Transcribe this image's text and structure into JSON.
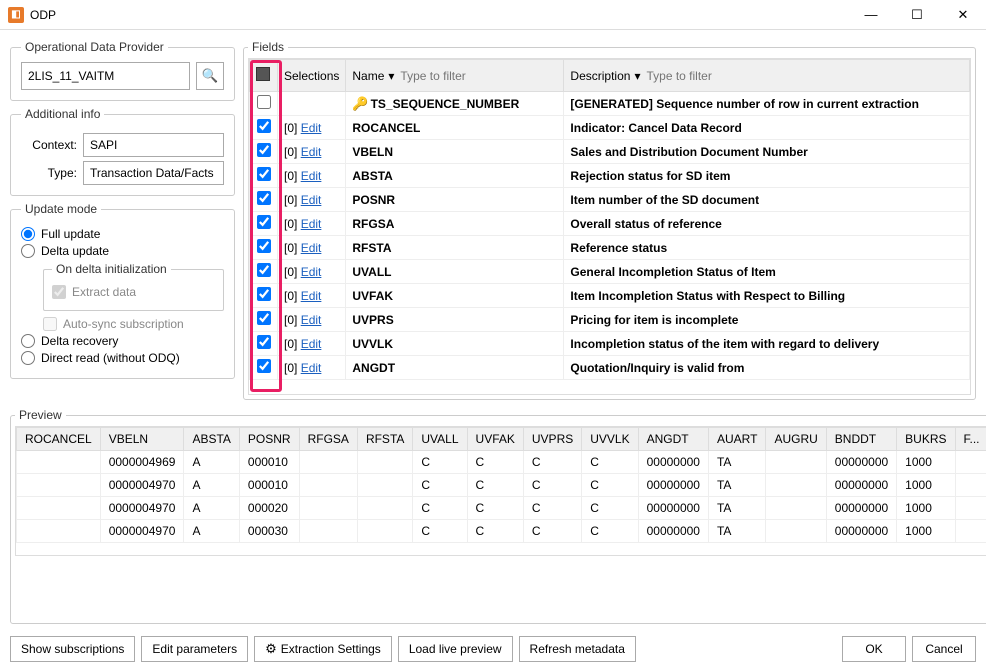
{
  "window": {
    "title": "ODP"
  },
  "odp": {
    "legend": "Operational Data Provider",
    "value": "2LIS_11_VAITM"
  },
  "additional": {
    "legend": "Additional info",
    "context_label": "Context:",
    "context_value": "SAPI",
    "type_label": "Type:",
    "type_value": "Transaction Data/Facts"
  },
  "update": {
    "legend": "Update mode",
    "full": "Full update",
    "delta": "Delta update",
    "delta_init_legend": "On delta initialization",
    "extract": "Extract data",
    "autosync": "Auto-sync subscription",
    "recovery": "Delta recovery",
    "direct": "Direct read (without ODQ)"
  },
  "fields": {
    "legend": "Fields",
    "selections_header": "Selections",
    "name_header": "Name",
    "name_placeholder": "Type to filter",
    "desc_header": "Description",
    "desc_placeholder": "Type to filter",
    "sel_text": "[0]",
    "edit_text": "Edit",
    "rows": [
      {
        "checked": false,
        "key": true,
        "sel": false,
        "name": "TS_SEQUENCE_NUMBER",
        "desc": "[GENERATED] Sequence number of row in current extraction"
      },
      {
        "checked": true,
        "key": false,
        "sel": true,
        "name": "ROCANCEL",
        "desc": "Indicator: Cancel Data Record"
      },
      {
        "checked": true,
        "key": false,
        "sel": true,
        "name": "VBELN",
        "desc": "Sales and Distribution Document Number"
      },
      {
        "checked": true,
        "key": false,
        "sel": true,
        "name": "ABSTA",
        "desc": "Rejection status for SD item"
      },
      {
        "checked": true,
        "key": false,
        "sel": true,
        "name": "POSNR",
        "desc": "Item number of the SD document"
      },
      {
        "checked": true,
        "key": false,
        "sel": true,
        "name": "RFGSA",
        "desc": "Overall status of reference"
      },
      {
        "checked": true,
        "key": false,
        "sel": true,
        "name": "RFSTA",
        "desc": "Reference status"
      },
      {
        "checked": true,
        "key": false,
        "sel": true,
        "name": "UVALL",
        "desc": "General Incompletion Status of Item"
      },
      {
        "checked": true,
        "key": false,
        "sel": true,
        "name": "UVFAK",
        "desc": "Item Incompletion Status with Respect to Billing"
      },
      {
        "checked": true,
        "key": false,
        "sel": true,
        "name": "UVPRS",
        "desc": "Pricing for item is incomplete"
      },
      {
        "checked": true,
        "key": false,
        "sel": true,
        "name": "UVVLK",
        "desc": "Incompletion status of the item with regard to delivery"
      },
      {
        "checked": true,
        "key": false,
        "sel": true,
        "name": "ANGDT",
        "desc": "Quotation/Inquiry is valid from"
      }
    ]
  },
  "preview": {
    "legend": "Preview",
    "columns": [
      "ROCANCEL",
      "VBELN",
      "ABSTA",
      "POSNR",
      "RFGSA",
      "RFSTA",
      "UVALL",
      "UVFAK",
      "UVPRS",
      "UVVLK",
      "ANGDT",
      "AUART",
      "AUGRU",
      "BNDDT",
      "BUKRS",
      "F..."
    ],
    "rows": [
      [
        "",
        "0000004969",
        "A",
        "000010",
        "",
        "",
        "C",
        "C",
        "C",
        "C",
        "00000000",
        "TA",
        "",
        "00000000",
        "1000",
        ""
      ],
      [
        "",
        "0000004970",
        "A",
        "000010",
        "",
        "",
        "C",
        "C",
        "C",
        "C",
        "00000000",
        "TA",
        "",
        "00000000",
        "1000",
        ""
      ],
      [
        "",
        "0000004970",
        "A",
        "000020",
        "",
        "",
        "C",
        "C",
        "C",
        "C",
        "00000000",
        "TA",
        "",
        "00000000",
        "1000",
        ""
      ],
      [
        "",
        "0000004970",
        "A",
        "000030",
        "",
        "",
        "C",
        "C",
        "C",
        "C",
        "00000000",
        "TA",
        "",
        "00000000",
        "1000",
        ""
      ]
    ]
  },
  "footer": {
    "show_subs": "Show subscriptions",
    "edit_params": "Edit parameters",
    "extraction": "Extraction Settings",
    "load_preview": "Load live preview",
    "refresh": "Refresh metadata",
    "ok": "OK",
    "cancel": "Cancel"
  }
}
